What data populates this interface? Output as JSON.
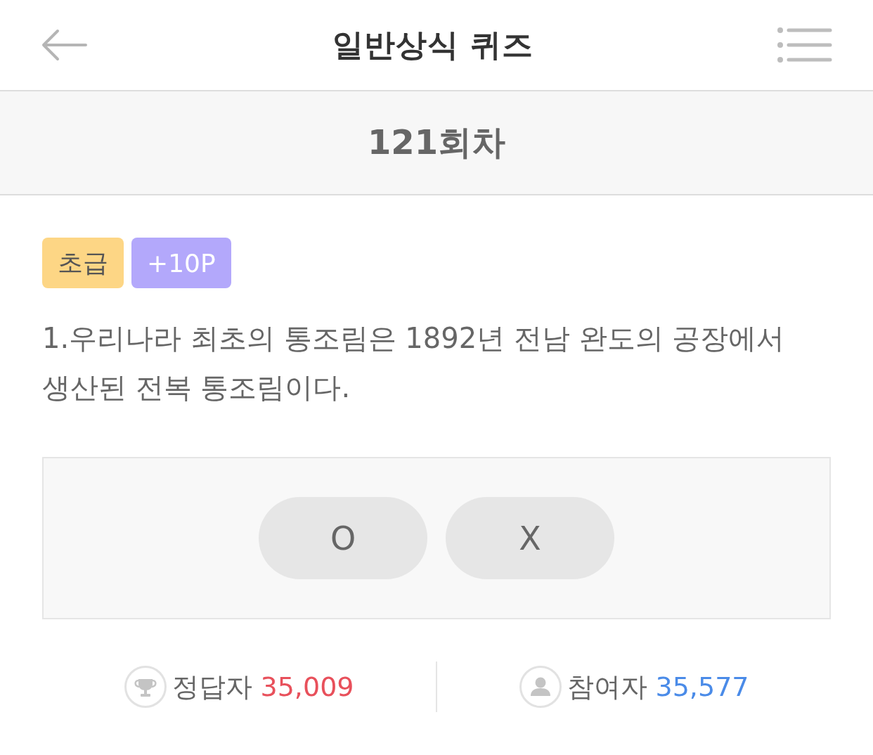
{
  "header": {
    "title": "일반상식 퀴즈"
  },
  "round": {
    "label": "121회차"
  },
  "badges": [
    {
      "kind": "level",
      "label": "초급",
      "color": "#fdd685"
    },
    {
      "kind": "points",
      "label": "+10P",
      "color": "#b3a8fb"
    }
  ],
  "question": {
    "text": "1.우리나라 최초의 통조림은 1892년 전남 완도의 공장에서 생산된 전복 통조림이다."
  },
  "answers": [
    {
      "label": "O",
      "selected": false
    },
    {
      "label": "X",
      "selected": false
    }
  ],
  "stats": [
    {
      "kind": "correct",
      "label": "정답자",
      "value": "35,009",
      "color": "#e8505b"
    },
    {
      "kind": "participants",
      "label": "참여자",
      "value": "35,577",
      "color": "#4a8be8"
    }
  ]
}
